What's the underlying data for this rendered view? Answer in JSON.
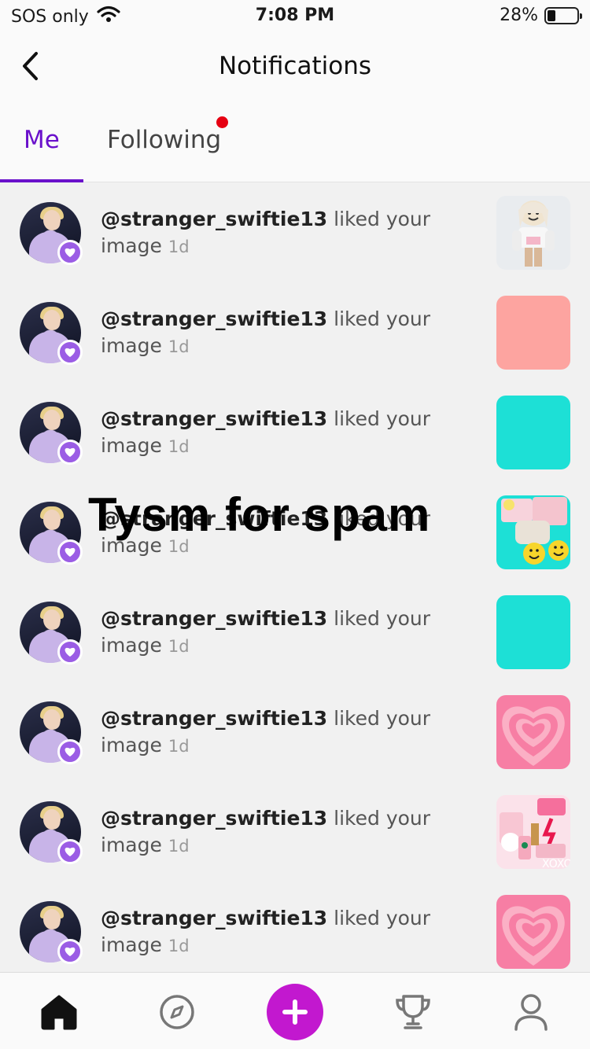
{
  "status_bar": {
    "carrier": "SOS only",
    "time": "7:08 PM",
    "battery_percent": "28%",
    "battery_level": 0.28
  },
  "nav": {
    "title": "Notifications",
    "back_icon": "chevron-left-icon"
  },
  "tabs": [
    {
      "label": "Me",
      "active": true
    },
    {
      "label": "Following",
      "active": false,
      "has_dot": true
    }
  ],
  "colors": {
    "accent": "#6a11cb",
    "badge": "#9b5de5",
    "add_button": "#c218cf",
    "dot": "#e60012",
    "thumb_salmon": "#fda4a0",
    "thumb_teal": "#1de0d6",
    "thumb_pink": "#f98fb0"
  },
  "notifications": [
    {
      "user": "@stranger_swiftie13",
      "action": "liked your",
      "object": "image",
      "time": "1d",
      "thumb": "roblox-avatar"
    },
    {
      "user": "@stranger_swiftie13",
      "action": "liked your",
      "object": "image",
      "time": "1d",
      "thumb": "salmon"
    },
    {
      "user": "@stranger_swiftie13",
      "action": "liked your",
      "object": "image",
      "time": "1d",
      "thumb": "teal"
    },
    {
      "user": "@stranger_swiftie13",
      "action": "liked your",
      "object": "image",
      "time": "1d",
      "thumb": "smiley-collage"
    },
    {
      "user": "@stranger_swiftie13",
      "action": "liked your",
      "object": "image",
      "time": "1d",
      "thumb": "teal"
    },
    {
      "user": "@stranger_swiftie13",
      "action": "liked your",
      "object": "image",
      "time": "1d",
      "thumb": "pink-heart"
    },
    {
      "user": "@stranger_swiftie13",
      "action": "liked your",
      "object": "image",
      "time": "1d",
      "thumb": "pink-collage"
    },
    {
      "user": "@stranger_swiftie13",
      "action": "liked your",
      "object": "image",
      "time": "1d",
      "thumb": "pink-heart"
    }
  ],
  "overlay_caption": "Tysm for spam",
  "tab_bar": {
    "icons": [
      "home-icon",
      "explore-compass-icon",
      "add-icon",
      "trophy-icon",
      "profile-icon"
    ]
  }
}
